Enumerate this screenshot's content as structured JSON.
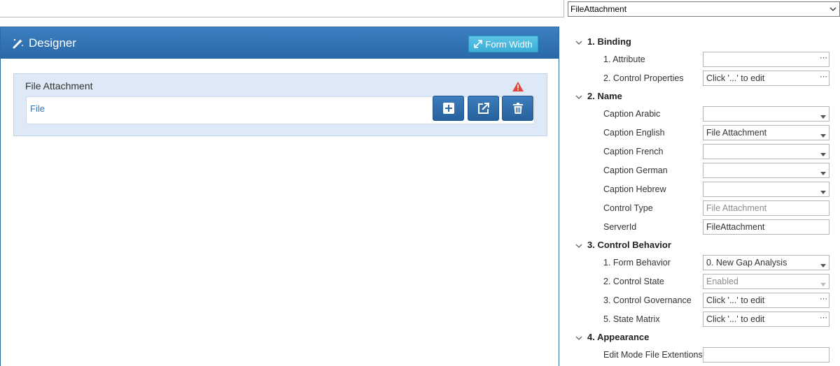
{
  "designer": {
    "title": "Designer",
    "form_width_label": "Form Width",
    "control": {
      "caption": "File Attachment",
      "field_label": "File"
    },
    "buttons": [
      {
        "name": "add-button",
        "icon": "plus-icon"
      },
      {
        "name": "open-button",
        "icon": "external-link-icon"
      },
      {
        "name": "delete-button",
        "icon": "trash-icon"
      }
    ]
  },
  "properties": {
    "selected_object": "FileAttachment",
    "categories": [
      {
        "label": "1. Binding",
        "rows": [
          {
            "name": "1. Attribute",
            "value": "",
            "editor": "ellipsis"
          },
          {
            "name": "2. Control Properties",
            "value": "Click '...' to edit",
            "editor": "ellipsis"
          }
        ]
      },
      {
        "label": "2. Name",
        "rows": [
          {
            "name": "Caption Arabic",
            "value": "",
            "editor": "dropdown"
          },
          {
            "name": "Caption English",
            "value": "File Attachment",
            "editor": "dropdown"
          },
          {
            "name": "Caption French",
            "value": "",
            "editor": "dropdown"
          },
          {
            "name": "Caption German",
            "value": "",
            "editor": "dropdown"
          },
          {
            "name": "Caption Hebrew",
            "value": "",
            "editor": "dropdown"
          },
          {
            "name": "Control Type",
            "value": "File Attachment",
            "editor": "readonly"
          },
          {
            "name": "ServerId",
            "value": "FileAttachment",
            "editor": "text"
          }
        ]
      },
      {
        "label": "3. Control Behavior",
        "rows": [
          {
            "name": "1. Form Behavior",
            "value": "0. New Gap Analysis",
            "editor": "dropdown"
          },
          {
            "name": "2. Control State",
            "value": "Enabled",
            "editor": "dropdown-disabled"
          },
          {
            "name": "3. Control Governance",
            "value": "Click '...' to edit",
            "editor": "ellipsis"
          },
          {
            "name": "5. State Matrix",
            "value": "Click '...' to edit",
            "editor": "ellipsis"
          }
        ]
      },
      {
        "label": "4. Appearance",
        "rows": [
          {
            "name": "Edit Mode File Extentions",
            "value": "",
            "editor": "text"
          }
        ]
      }
    ]
  },
  "colors": {
    "header_blue": "#2a68a8",
    "accent_cyan": "#3aaed6",
    "card_bg": "#dde9f6",
    "warning_red": "#e0463b"
  }
}
